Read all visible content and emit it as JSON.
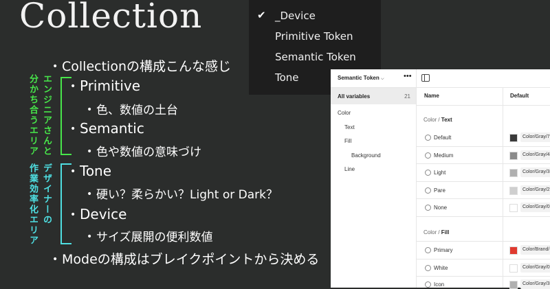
{
  "title": "Collection",
  "bullets": [
    {
      "text": "Collectionの構成こんな感じ"
    },
    {
      "text": "Primitive"
    },
    {
      "text": "色、数値の土台"
    },
    {
      "text": "Semantic"
    },
    {
      "text": "色や数値の意味づけ"
    },
    {
      "text": "Tone"
    },
    {
      "text": "硬い？柔らかい？Light or Dark？"
    },
    {
      "text": "Device"
    },
    {
      "text": "サイズ展開の便利数値"
    },
    {
      "text": "Modeの構成はブレイクポイントから決める"
    }
  ],
  "labels": {
    "engineer_col1": "分かち合うエリア",
    "engineer_col2": "エンジニアさんと",
    "designer_col1": "作業効率化エリア",
    "designer_col2": "デザイナーの",
    "green": "#47e64a",
    "cyan": "#4fe0e3"
  },
  "menu": {
    "items": [
      "_Device",
      "Primitive Token",
      "Semantic Token",
      "Tone"
    ],
    "checked_index": 0
  },
  "panel": {
    "collection": "Semantic Token",
    "more": "•••",
    "all_variables": "All variables",
    "count": "21",
    "groups": [
      "Color",
      "Text",
      "Fill",
      "Background",
      "Line"
    ],
    "columns": {
      "name": "Name",
      "default": "Default"
    },
    "section_text": {
      "prefix": "Color / ",
      "name": "Text"
    },
    "section_fill": {
      "prefix": "Color / ",
      "name": "Fill"
    },
    "text_rows": [
      {
        "name": "Default",
        "value": "Color/Gray/7",
        "color": "#3a3a3a"
      },
      {
        "name": "Medium",
        "value": "Color/Gray/4",
        "color": "#8c8c8c"
      },
      {
        "name": "Light",
        "value": "Color/Gray/3",
        "color": "#b0b0b0"
      },
      {
        "name": "Pare",
        "value": "Color/Gray/2",
        "color": "#cfcfcf"
      },
      {
        "name": "None",
        "value": "Color/Gray/0",
        "color": "#ffffff"
      }
    ],
    "fill_rows": [
      {
        "name": "Primary",
        "value": "Color/Brand/",
        "color": "#e03a2f"
      },
      {
        "name": "White",
        "value": "Color/Gray/0",
        "color": "#ffffff"
      },
      {
        "name": "Icon",
        "value": "Color/Gray/3",
        "color": "#b0b0b0"
      }
    ]
  }
}
